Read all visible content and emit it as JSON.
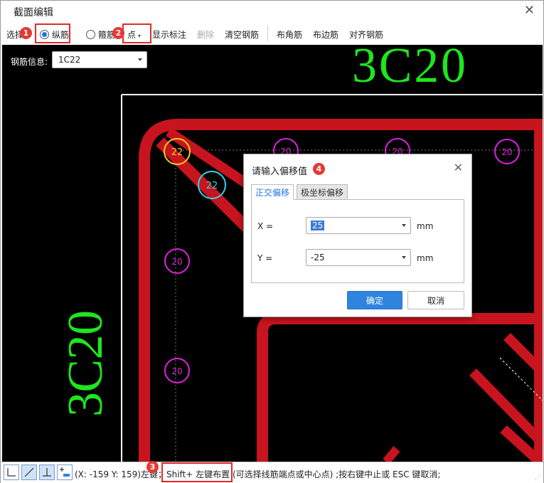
{
  "window": {
    "title": "截面编辑",
    "close_glyph": "✕"
  },
  "toolbar": {
    "select_label": "选择",
    "radio_long": "纵筋",
    "radio_stirrup": "箍筋",
    "mode_dropdown": "点",
    "show_annotation": "显示标注",
    "delete": "删除",
    "clear_rebar": "清空钢筋",
    "corner_rebar": "布角筋",
    "edge_rebar": "布边筋",
    "align_rebar": "对齐钢筋"
  },
  "rebar_info": {
    "label": "钢筋信息:",
    "value": "1C22"
  },
  "canvas": {
    "top_annotation": "3C20",
    "left_annotation": "3C20",
    "circle_labels": {
      "corner": "22",
      "inner": "22",
      "top_1": "20",
      "top_2": "20",
      "top_3": "20",
      "left_1": "20",
      "left_2": "20"
    }
  },
  "dialog": {
    "title": "请输入偏移值",
    "close_glyph": "✕",
    "tabs": [
      "正交偏移",
      "极坐标偏移"
    ],
    "x_label": "X =",
    "x_value": "25",
    "y_label": "Y =",
    "y_value": "-25",
    "unit": "mm",
    "ok": "确定",
    "cancel": "取消"
  },
  "status": {
    "coords": "(X: -159 Y: 159)左",
    "text_full": "(X: -159 Y: 159)左键；Shift+ 左键布置 (可选择线筋端点或中心点) ;按右键中止或 ESC 键取消;"
  },
  "badges": [
    "1",
    "2",
    "3",
    "4"
  ],
  "colors": {
    "rebar_red": "#c8141e",
    "annotation_green": "#1ee61e",
    "circle_magenta": "#e020e0",
    "circle_yellow": "#f0d020",
    "circle_cyan": "#30d8e8",
    "badge_red": "#e53935",
    "accent_blue": "#2f84e0"
  },
  "icons": [
    "close-icon",
    "ortho-line-icon",
    "diagonal-line-icon",
    "perpendicular-icon",
    "offset-point-icon",
    "dropdown-caret-icon",
    "resize-grip-icon"
  ]
}
